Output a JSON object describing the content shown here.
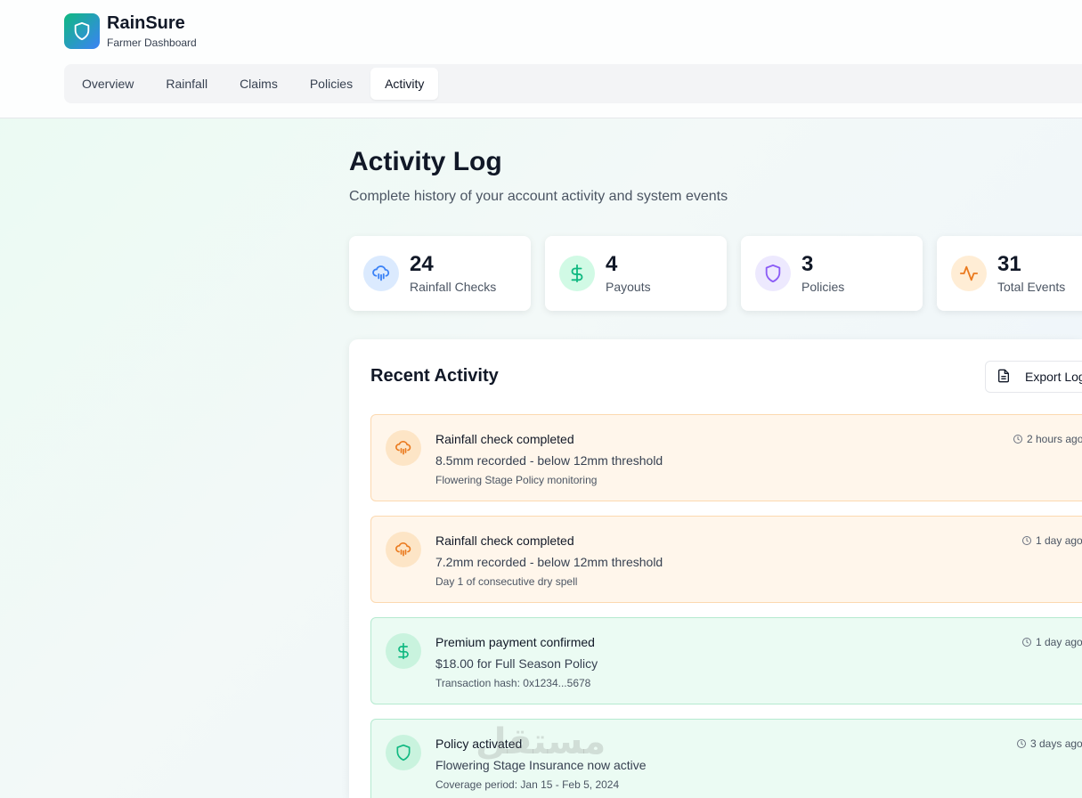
{
  "brand": {
    "name": "RainSure",
    "subtitle": "Farmer Dashboard",
    "icon": "shield-icon",
    "accent": "#10b981"
  },
  "tabs": [
    {
      "label": "Overview",
      "active": false
    },
    {
      "label": "Rainfall",
      "active": false
    },
    {
      "label": "Claims",
      "active": false
    },
    {
      "label": "Policies",
      "active": false
    },
    {
      "label": "Activity",
      "active": true
    }
  ],
  "page": {
    "title": "Activity Log",
    "subtitle": "Complete history of your account activity and system events"
  },
  "stats": [
    {
      "value": "24",
      "label": "Rainfall Checks",
      "icon": "cloud-rain-icon",
      "color": "#3b82f6"
    },
    {
      "value": "4",
      "label": "Payouts",
      "icon": "dollar-icon",
      "color": "#10b981"
    },
    {
      "value": "3",
      "label": "Policies",
      "icon": "shield-icon",
      "color": "#8b5cf6"
    },
    {
      "value": "31",
      "label": "Total Events",
      "icon": "activity-icon",
      "color": "#ea7a1f"
    }
  ],
  "activity": {
    "title": "Recent Activity",
    "export_label": "Export Log",
    "items": [
      {
        "title": "Rainfall check completed",
        "description": "8.5mm recorded - below 12mm threshold",
        "meta": "Flowering Stage Policy monitoring",
        "time": "2 hours ago",
        "type": "rainfall",
        "icon": "cloud-rain-icon"
      },
      {
        "title": "Rainfall check completed",
        "description": "7.2mm recorded - below 12mm threshold",
        "meta": "Day 1 of consecutive dry spell",
        "time": "1 day ago",
        "type": "rainfall",
        "icon": "cloud-rain-icon"
      },
      {
        "title": "Premium payment confirmed",
        "description": "$18.00 for Full Season Policy",
        "meta": "Transaction hash: 0x1234...5678",
        "time": "1 day ago",
        "type": "payment",
        "icon": "dollar-icon"
      },
      {
        "title": "Policy activated",
        "description": "Flowering Stage Insurance now active",
        "meta": "Coverage period: Jan 15 - Feb 5, 2024",
        "time": "3 days ago",
        "type": "policy",
        "icon": "shield-icon"
      }
    ]
  },
  "watermark": "مستقل"
}
